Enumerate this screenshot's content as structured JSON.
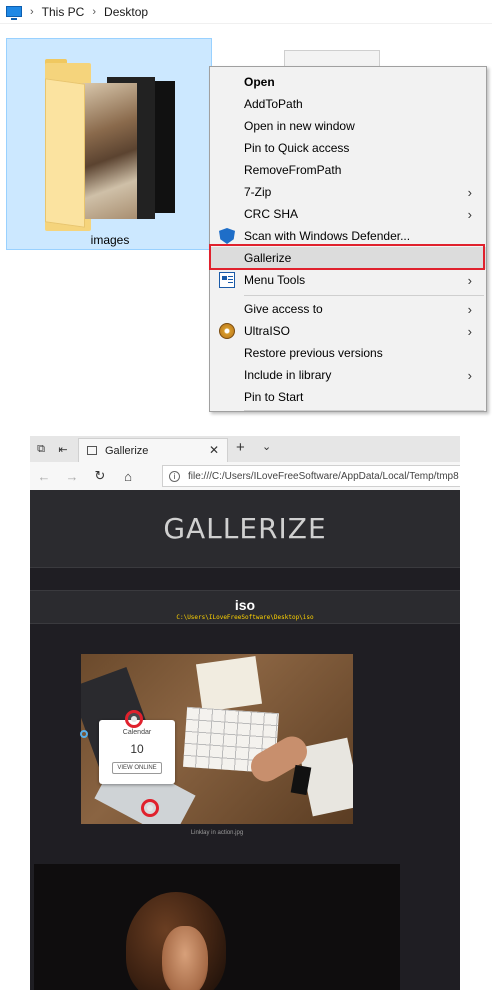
{
  "explorer": {
    "breadcrumb": [
      "This PC",
      "Desktop"
    ],
    "folder": {
      "label": "images"
    }
  },
  "context_menu": {
    "items": [
      {
        "label": "Open",
        "bold": true
      },
      {
        "label": "AddToPath"
      },
      {
        "label": "Open in new window"
      },
      {
        "label": "Pin to Quick access"
      },
      {
        "label": "RemoveFromPath"
      },
      {
        "label": "7-Zip",
        "submenu": true
      },
      {
        "label": "CRC SHA",
        "submenu": true
      },
      {
        "label": "Scan with Windows Defender...",
        "icon": "defender-shield-icon"
      },
      {
        "label": "Gallerize",
        "highlighted": true
      },
      {
        "label": "Menu Tools",
        "icon": "menu-tools-icon",
        "submenu": true
      },
      {
        "label": "Give access to",
        "submenu": true
      },
      {
        "label": "UltraISO",
        "icon": "ultraiso-disc-icon",
        "submenu": true
      },
      {
        "label": "Restore previous versions"
      },
      {
        "label": "Include in library",
        "submenu": true
      },
      {
        "label": "Pin to Start"
      }
    ],
    "highlight_color": "#e0212d"
  },
  "browser": {
    "tab_title": "Gallerize",
    "tab_close": "✕",
    "new_tab": "+",
    "tab_menu": "⌄",
    "url": "file:///C:/Users/ILoveFreeSoftware/AppData/Local/Temp/tmp8",
    "nav": {
      "back": "←",
      "forward": "→",
      "refresh": "↻",
      "home": "⌂"
    }
  },
  "gallery": {
    "title": "GALLERIZE",
    "section_title": "iso",
    "section_path": "C:\\Users\\ILoveFreeSoftware\\Desktop\\iso",
    "image1": {
      "widget_caption": "Calendar",
      "widget_number": "10",
      "widget_button": "VIEW ONLINE",
      "caption": "Linklay in action.jpg"
    }
  }
}
